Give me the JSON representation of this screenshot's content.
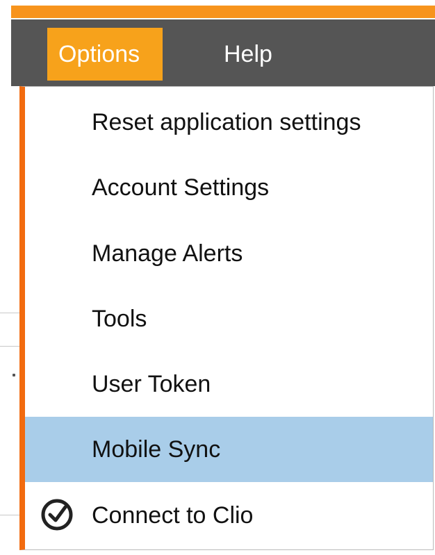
{
  "menubar": {
    "items": [
      {
        "label": "Options",
        "active": true
      },
      {
        "label": "Help",
        "active": false
      }
    ]
  },
  "dropdown": {
    "items": [
      {
        "label": "Reset application settings"
      },
      {
        "label": "Account Settings"
      },
      {
        "label": "Manage Alerts"
      },
      {
        "label": "Tools"
      },
      {
        "label": "User Token"
      },
      {
        "label": "Mobile Sync",
        "highlighted": true
      },
      {
        "label": "Connect to Clio",
        "icon": "checkmark-icon",
        "checked": true
      }
    ]
  },
  "colors": {
    "accent_orange": "#f7941d",
    "active_menu": "#f7a21b",
    "menubar_bg": "#555555",
    "dropdown_left_border": "#f26b0f",
    "highlight": "#a9cde9"
  }
}
